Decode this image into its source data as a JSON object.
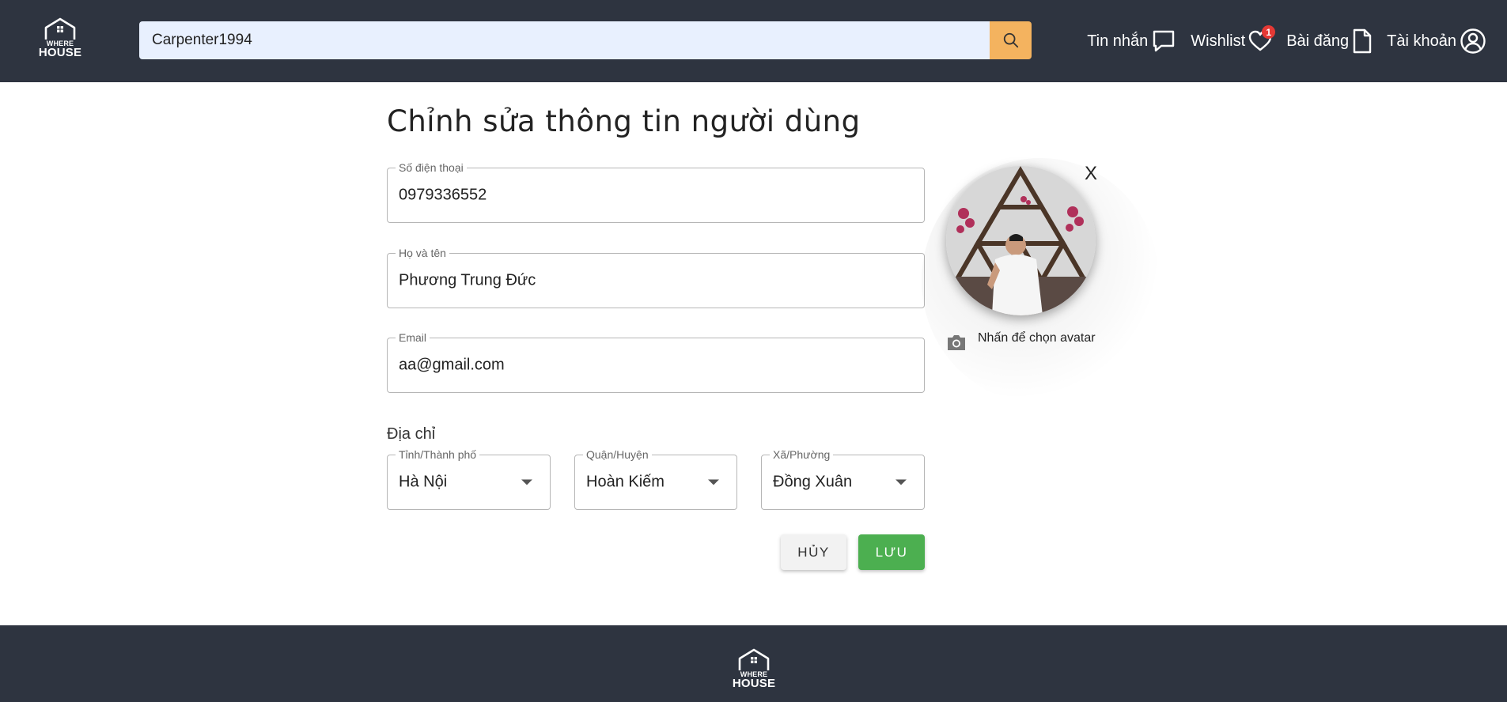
{
  "header": {
    "logo": {
      "line1": "WHERE",
      "line2": "HOUSE"
    },
    "search": {
      "value": "Carpenter1994",
      "icon": "search-icon"
    },
    "nav": [
      {
        "label": "Tin nhắn",
        "icon": "chat-bubble-icon"
      },
      {
        "label": "Wishlist",
        "icon": "heart-icon",
        "badge": "1"
      },
      {
        "label": "Bài đăng",
        "icon": "document-icon"
      },
      {
        "label": "Tài khoản",
        "icon": "user-circle-icon"
      }
    ]
  },
  "form": {
    "title": "Chỉnh sửa thông tin người dùng",
    "phone": {
      "label": "Số điện thoại",
      "value": "0979336552"
    },
    "name": {
      "label": "Họ và tên",
      "value": "Phương Trung Đức"
    },
    "email": {
      "label": "Email",
      "value": "aa@gmail.com"
    },
    "address": {
      "heading": "Địa chỉ",
      "province": {
        "label": "Tỉnh/Thành phố",
        "value": "Hà Nội"
      },
      "district": {
        "label": "Quận/Huyện",
        "value": "Hoàn Kiếm"
      },
      "ward": {
        "label": "Xã/Phường",
        "value": "Đồng Xuân"
      }
    },
    "cancel_label": "HỦY",
    "save_label": "LƯU"
  },
  "avatar": {
    "close_label": "X",
    "hint": "Nhấn để chọn avatar",
    "camera_icon": "camera-icon"
  },
  "footer": {
    "logo": {
      "line1": "WHERE",
      "line2": "HOUSE"
    }
  },
  "colors": {
    "header_bg": "#2e3440",
    "search_bg": "#e8f0fe",
    "search_button": "#f4b35f",
    "save_button": "#4caf50",
    "badge": "#e53935"
  }
}
